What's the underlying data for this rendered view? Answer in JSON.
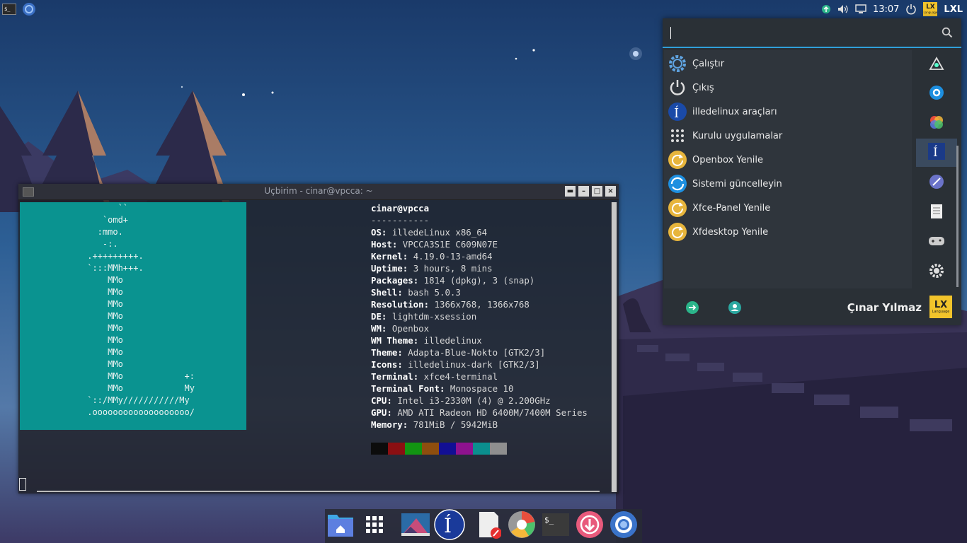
{
  "top_panel": {
    "clock": "13:07",
    "brand_label": "LXL",
    "badge_text": "LX",
    "badge_subtext": "Language"
  },
  "terminal": {
    "title": "Uçbirim - cinar@vpcca: ~",
    "buttons": [
      "▬",
      "–",
      "□",
      "×"
    ],
    "ascii_logo": [
      "       ``",
      "    `omd+",
      "   :mmo.",
      "    -:.",
      " .+++++++++.",
      " `:::MMh+++.",
      "     MMo",
      "     MMo",
      "     MMo",
      "     MMo",
      "     MMo",
      "     MMo",
      "     MMo",
      "     MMo",
      "     MMo            +:",
      "     MMo            My",
      " `::/MMy///////////My",
      " .ooooooooooooooooooo/"
    ],
    "user_host": "cinar@vpcca",
    "separator": "-----------",
    "info": [
      {
        "key": "OS",
        "value": "illedeLinux x86_64"
      },
      {
        "key": "Host",
        "value": "VPCCA3S1E C609N07E"
      },
      {
        "key": "Kernel",
        "value": "4.19.0-13-amd64"
      },
      {
        "key": "Uptime",
        "value": "3 hours, 8 mins"
      },
      {
        "key": "Packages",
        "value": "1814 (dpkg), 3 (snap)"
      },
      {
        "key": "Shell",
        "value": "bash 5.0.3"
      },
      {
        "key": "Resolution",
        "value": "1366x768, 1366x768"
      },
      {
        "key": "DE",
        "value": "lightdm-xsession"
      },
      {
        "key": "WM",
        "value": "Openbox"
      },
      {
        "key": "WM Theme",
        "value": "illedelinux"
      },
      {
        "key": "Theme",
        "value": "Adapta-Blue-Nokto [GTK2/3]"
      },
      {
        "key": "Icons",
        "value": "illedelinux-dark [GTK2/3]"
      },
      {
        "key": "Terminal",
        "value": "xfce4-terminal"
      },
      {
        "key": "Terminal Font",
        "value": "Monospace 10"
      },
      {
        "key": "CPU",
        "value": "Intel i3-2330M (4) @ 2.200GHz"
      },
      {
        "key": "GPU",
        "value": "AMD ATI Radeon HD 6400M/7400M Series"
      },
      {
        "key": "Memory",
        "value": "781MiB / 5942MiB"
      }
    ],
    "color_swatches": [
      "#0c0c0c",
      "#8b0f12",
      "#129412",
      "#8e4e0e",
      "#120f94",
      "#8e128e",
      "#0b8f8e",
      "#8f8f8f"
    ]
  },
  "menu": {
    "search_value": "",
    "items": [
      {
        "label": "Çalıştır",
        "icon": "gear-icon"
      },
      {
        "label": "Çıkış",
        "icon": "power-icon"
      },
      {
        "label": "illedelinux araçları",
        "icon": "illedelinux-icon"
      },
      {
        "label": "Kurulu uygulamalar",
        "icon": "app-grid-icon"
      },
      {
        "label": "Openbox Yenile",
        "icon": "refresh-icon"
      },
      {
        "label": "Sistemi güncelleyin",
        "icon": "system-update-icon"
      },
      {
        "label": "Xfce-Panel Yenile",
        "icon": "refresh-icon"
      },
      {
        "label": "Xfdesktop Yenile",
        "icon": "refresh-icon"
      }
    ],
    "categories": [
      "graphics-icon",
      "settings-icon",
      "office-suite-icon",
      "illedelinux-icon",
      "internet-icon",
      "accessories-icon",
      "games-icon",
      "system-icon"
    ],
    "active_category": 3,
    "user_name": "Çınar Yılmaz",
    "user_badge": "LX",
    "user_badge_sub": "Language"
  },
  "dock": {
    "items": [
      "home-folder-icon",
      "app-grid-icon",
      "image-viewer-icon",
      "illedelinux-icon",
      "text-editor-icon",
      "disk-usage-icon",
      "terminal-icon",
      "download-icon",
      "browser-icon"
    ]
  },
  "colors": {
    "accent": "#2f9fd9",
    "terminal_logo_bg": "#0a9390",
    "badge": "#f2c42b",
    "refresh_yellow": "#e7b53c"
  }
}
